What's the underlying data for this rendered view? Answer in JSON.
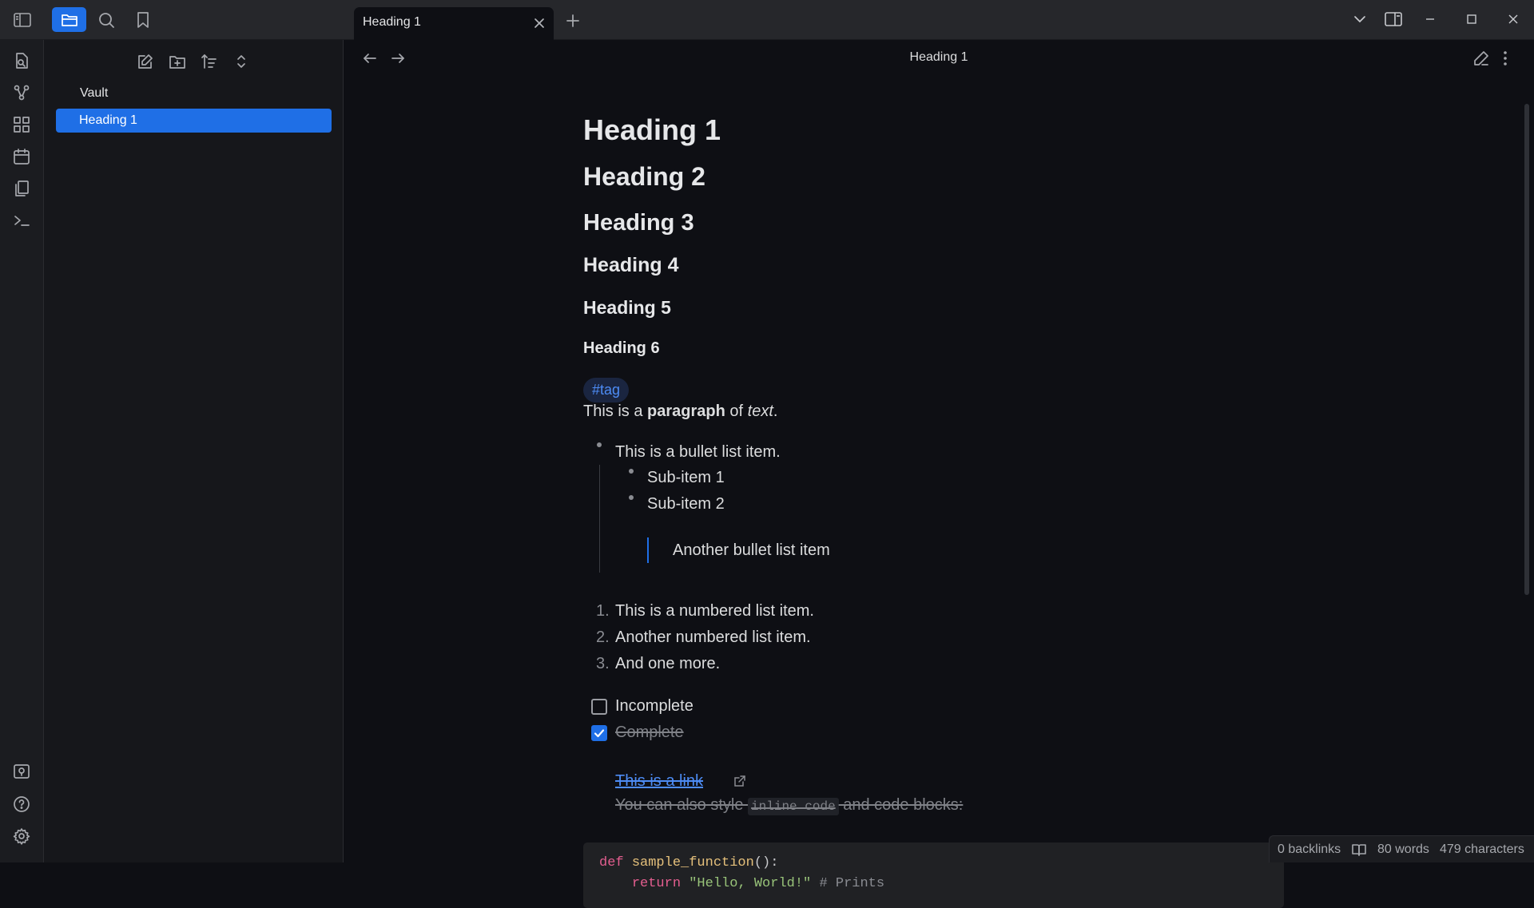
{
  "titlebar": {
    "tab_title": "Heading 1",
    "icons": [
      "sidebar-toggle-icon",
      "folder-icon",
      "search-icon",
      "bookmark-icon",
      "plus-icon",
      "chevron-down-icon",
      "split-view-icon",
      "minimize-icon",
      "maximize-icon",
      "close-icon"
    ]
  },
  "ribbon": {
    "icons": [
      "open-quick-switcher-icon",
      "graph-view-icon",
      "canvas-icon",
      "daily-note-icon",
      "templates-icon",
      "command-palette-icon",
      "vault-switcher-icon",
      "help-icon",
      "settings-icon"
    ]
  },
  "explorer": {
    "tools": [
      "new-note-icon",
      "new-folder-icon",
      "sort-icon",
      "collapse-all-icon"
    ],
    "vault_name": "Vault",
    "files": [
      {
        "name": "Heading 1",
        "active": true
      }
    ]
  },
  "editor": {
    "view_title": "Heading 1",
    "headings": [
      "Heading 1",
      "Heading 2",
      "Heading 3",
      "Heading 4",
      "Heading 5",
      "Heading 6"
    ],
    "tag": "#tag",
    "paragraph": {
      "pre": "This is a ",
      "bold": "paragraph",
      "mid": " of ",
      "italic": "text",
      "post": "."
    },
    "bullets": {
      "item": "This is a bullet list item.",
      "sub_items": [
        "Sub-item 1",
        "Sub-item 2"
      ],
      "quote": "Another bullet list item"
    },
    "numbered": [
      {
        "num": "1.",
        "text": "This is a numbered list item."
      },
      {
        "num": "2.",
        "text": "Another numbered list item."
      },
      {
        "num": "3.",
        "text": "And one more."
      }
    ],
    "tasks": [
      {
        "label": "Incomplete",
        "checked": false
      },
      {
        "label": "Complete",
        "checked": true
      }
    ],
    "link_text": "This is a link",
    "code_sentence": {
      "pre": "You can also style ",
      "code": "inline code",
      "post": " and code blocks:"
    },
    "code_block": {
      "line1": {
        "kw": "def",
        "fn": "sample_function",
        "punc": "():"
      },
      "line2": {
        "kw": "return",
        "str": "\"Hello, World!\"",
        "cmt": "# Prints"
      }
    }
  },
  "statusbar": {
    "backlinks": "0 backlinks",
    "words": "80 words",
    "characters": "479 characters"
  },
  "colors": {
    "accent": "#1f6fe6",
    "background": "#0e0f14",
    "sidebar": "#16171b",
    "titlebar": "#26272b",
    "link": "#4d8cf5"
  }
}
